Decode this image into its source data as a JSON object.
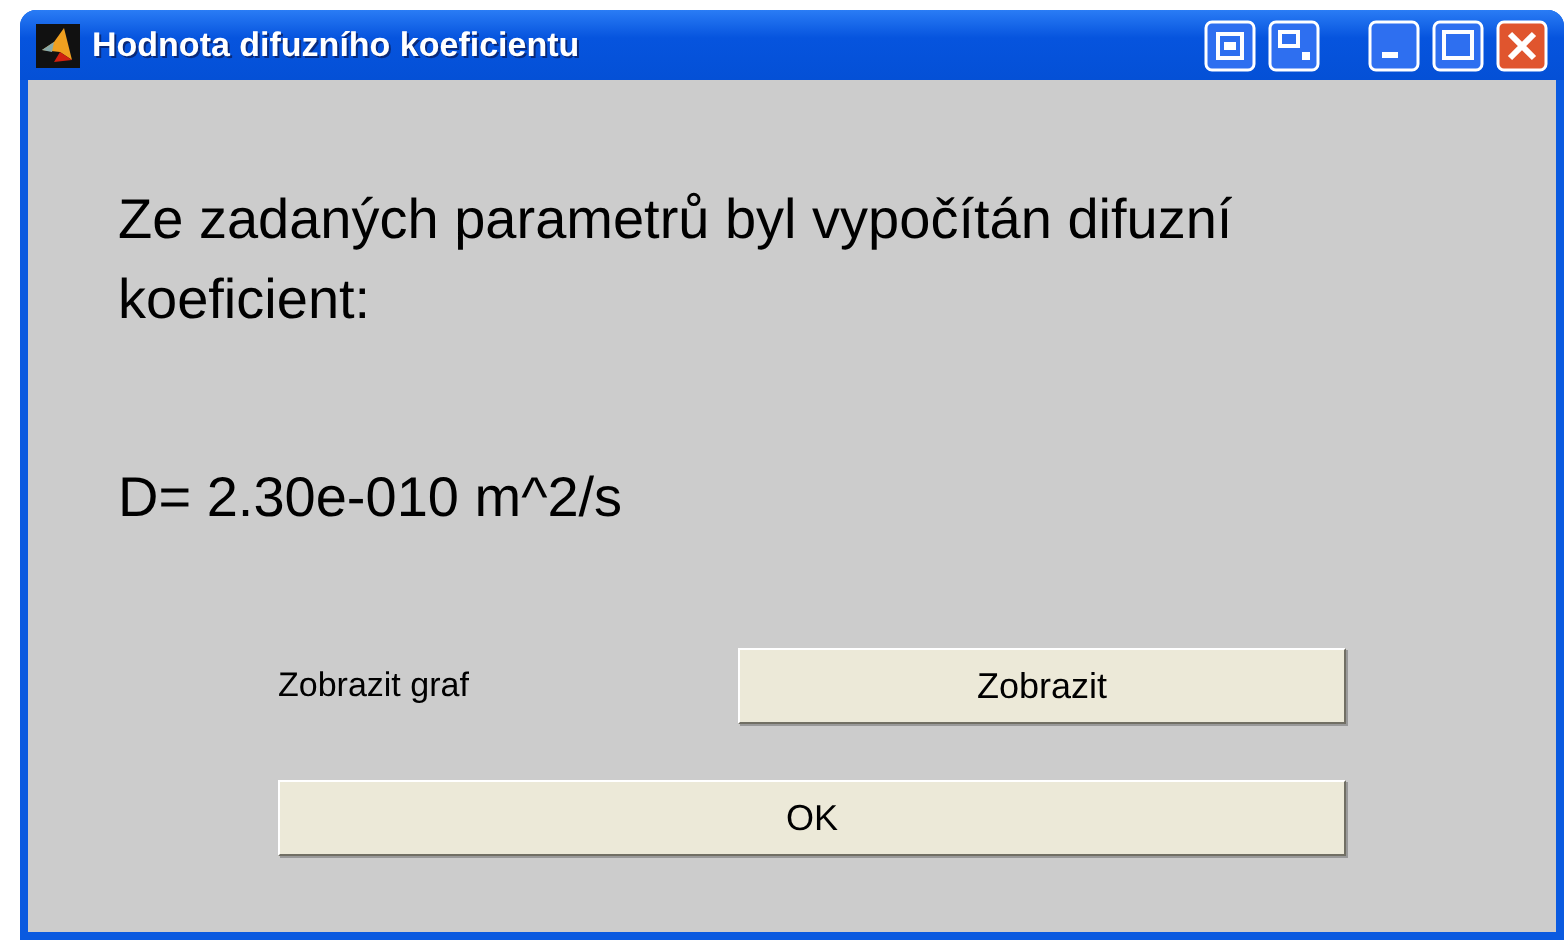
{
  "window": {
    "title": "Hodnota difuzního koeficientu"
  },
  "message": "Ze zadaných parametrů byl vypočítán difuzní koeficient:",
  "result": "D= 2.30e-010 m^2/s",
  "graph_row": {
    "label": "Zobrazit graf",
    "button": "Zobrazit"
  },
  "ok_button": "OK"
}
